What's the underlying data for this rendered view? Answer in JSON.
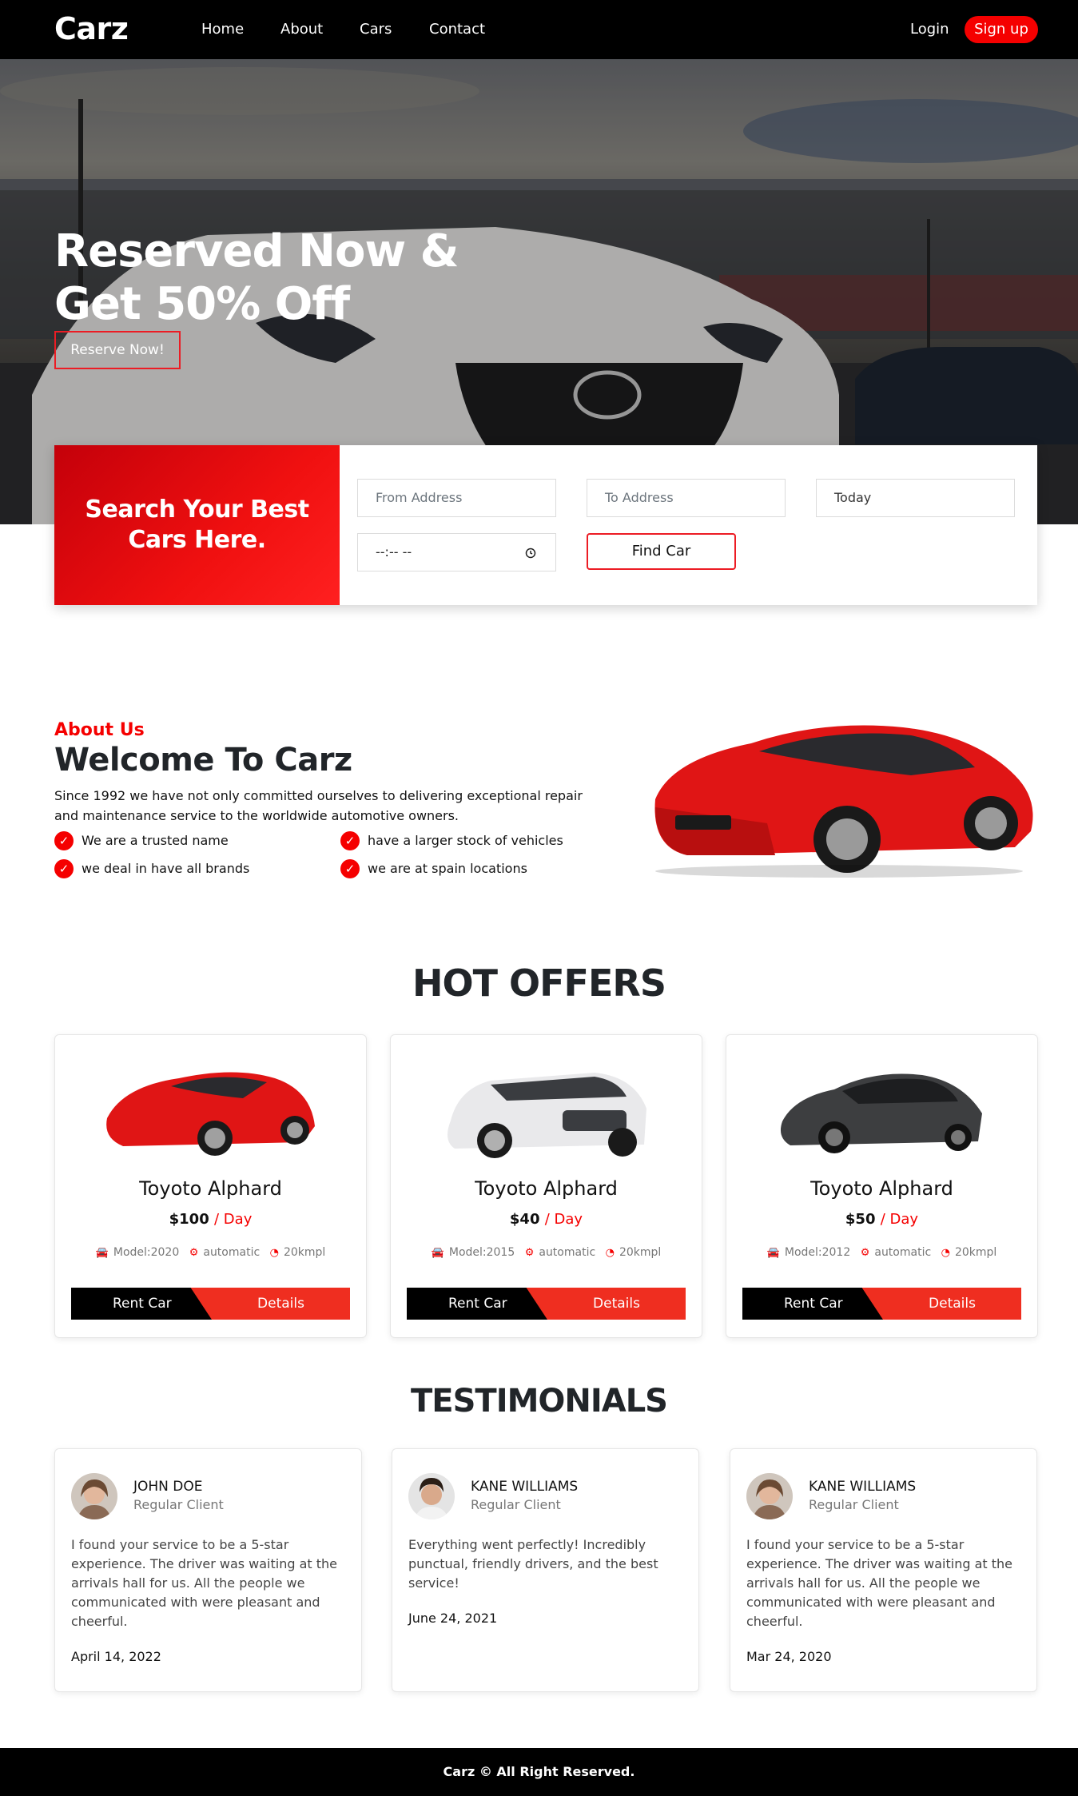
{
  "nav": {
    "brand": "Carz",
    "links": [
      "Home",
      "About",
      "Cars",
      "Contact"
    ],
    "login": "Login",
    "signup": "Sign up"
  },
  "hero": {
    "title_line1": "Reserved Now &",
    "title_line2": "Get 50% Off",
    "cta": "Reserve Now!"
  },
  "search": {
    "title_line1": "Search Your Best",
    "title_line2": "Cars Here.",
    "from_placeholder": "From Address",
    "to_placeholder": "To Address",
    "date_value": "Today",
    "time_value": "--:-- --",
    "submit": "Find Car"
  },
  "about": {
    "kicker": "About Us",
    "title": "Welcome To Carz",
    "text": "Since 1992 we have not only committed ourselves to delivering exceptional repair and maintenance service to the worldwide automotive owners.",
    "checks": [
      "We are a trusted name",
      "have a larger stock of vehicles",
      "we deal in have all brands",
      "we are at spain locations"
    ]
  },
  "offers": {
    "title": "HOT OFFERS",
    "per_day": "/ Day",
    "rent_label": "Rent Car",
    "details_label": "Details",
    "items": [
      {
        "name": "Toyoto Alphard",
        "price": "$100",
        "model": "Model:2020",
        "transmission": "automatic",
        "mileage": "20kmpl",
        "color": "red"
      },
      {
        "name": "Toyoto Alphard",
        "price": "$40",
        "model": "Model:2015",
        "transmission": "automatic",
        "mileage": "20kmpl",
        "color": "white"
      },
      {
        "name": "Toyoto Alphard",
        "price": "$50",
        "model": "Model:2012",
        "transmission": "automatic",
        "mileage": "20kmpl",
        "color": "black"
      }
    ]
  },
  "testimonials": {
    "title": "TESTIMONIALS",
    "items": [
      {
        "name": "JOHN DOE",
        "role": "Regular Client",
        "text": "I found your service to be a 5-star experience. The driver was waiting at the arrivals hall for us. All the people we communicated with were pleasant and cheerful.",
        "date": "April 14, 2022"
      },
      {
        "name": "KANE WILLIAMS",
        "role": "Regular Client",
        "text": "Everything went perfectly! Incredibly punctual, friendly drivers, and the best service!",
        "date": "June 24, 2021"
      },
      {
        "name": "KANE WILLIAMS",
        "role": "Regular Client",
        "text": "I found your service to be a 5-star experience. The driver was waiting at the arrivals hall for us. All the people we communicated with were pleasant and cheerful.",
        "date": "Mar 24, 2020"
      }
    ]
  },
  "footer": {
    "text": "Carz © All Right Reserved."
  },
  "colors": {
    "accent": "#f50000",
    "nav_bg": "#000000",
    "button_red": "#ef2e20"
  },
  "icons": {
    "check": "check-circle-icon",
    "car": "car-icon",
    "gears": "gears-icon",
    "speedometer": "speedometer-icon",
    "clock": "clock-icon"
  }
}
